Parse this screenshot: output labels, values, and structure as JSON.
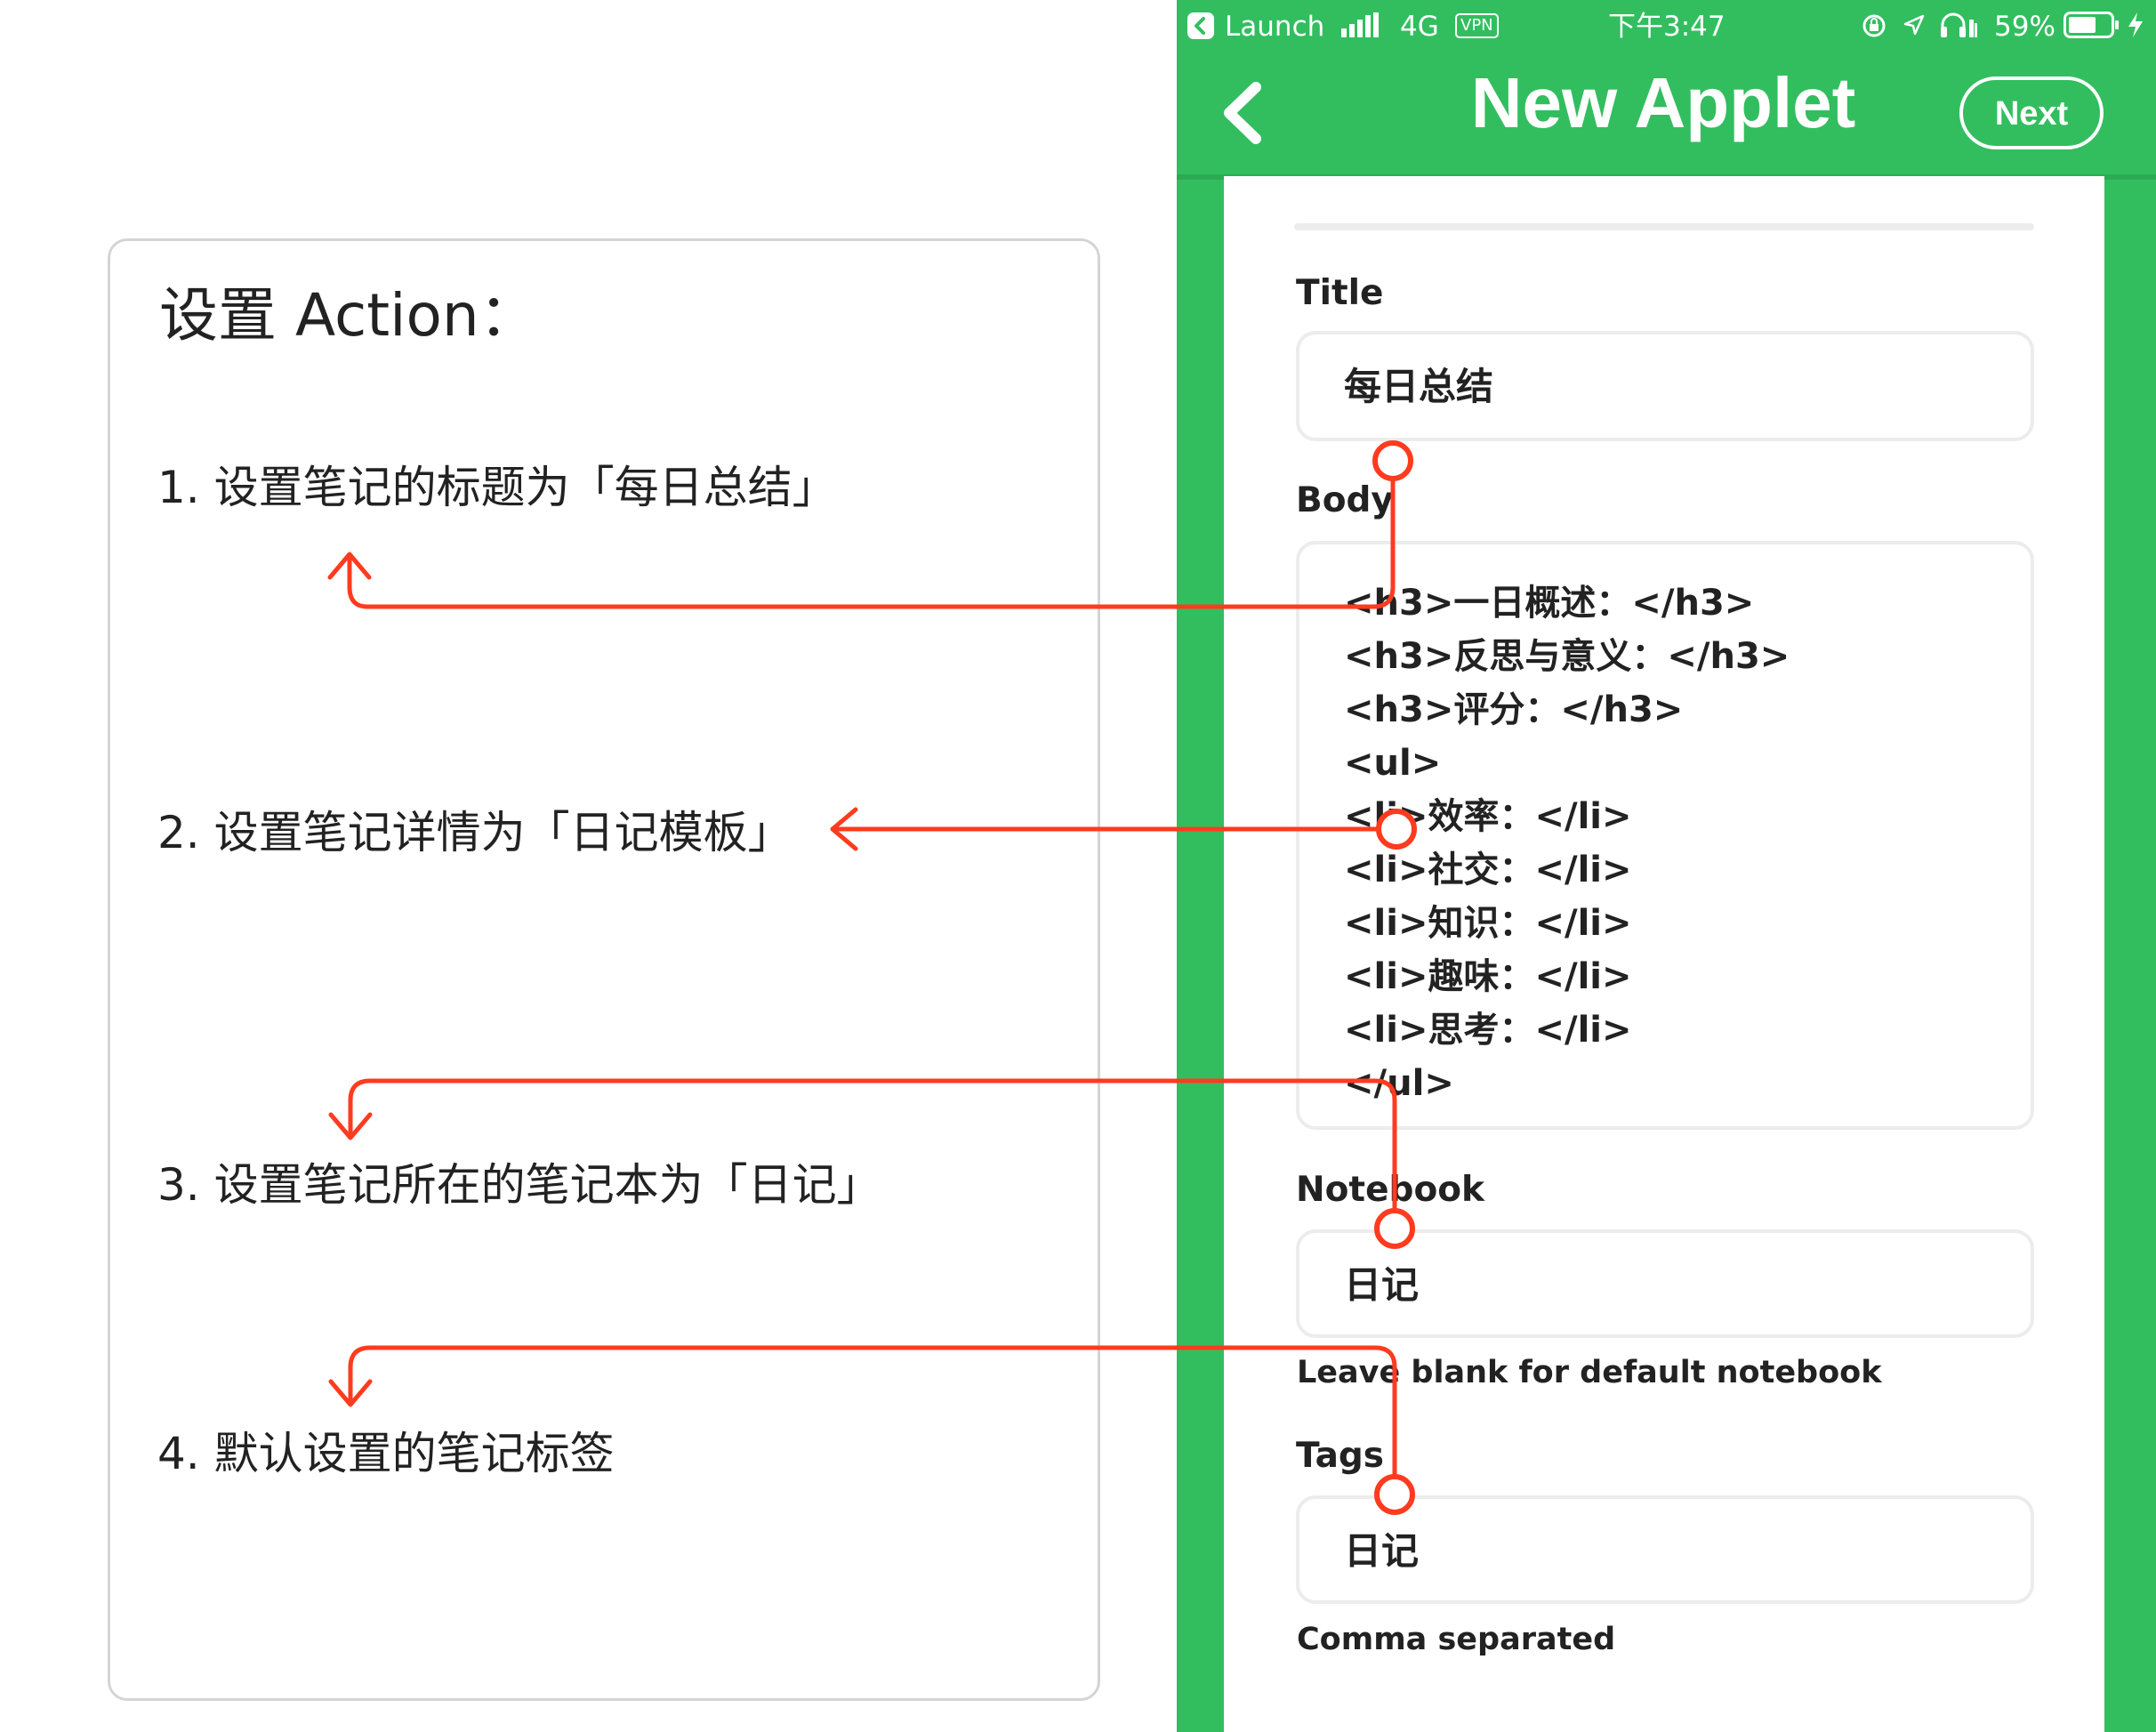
{
  "instructions": {
    "heading": "设置 Action：",
    "steps": [
      "1. 设置笔记的标题为「每日总结」",
      "2. 设置笔记详情为「日记模板」",
      "3. 设置笔记所在的笔记本为「日记」",
      "4. 默认设置的笔记标签"
    ]
  },
  "status_bar": {
    "back_app": "Launch",
    "network": "4G",
    "vpn": "VPN",
    "time": "下午3:47",
    "battery": "59%"
  },
  "nav": {
    "title": "New Applet",
    "next_label": "Next"
  },
  "form": {
    "title_label": "Title",
    "title_value": "每日总结",
    "body_label": "Body",
    "body_lines": [
      "<h3>一日概述：</h3>",
      "<h3>反思与意义：</h3>",
      "<h3>评分：</h3>",
      "<ul>",
      "<li>效率：</li>",
      "<li>社交：</li>",
      "<li>知识：</li>",
      "<li>趣味：</li>",
      "<li>思考：</li>",
      "</ul>"
    ],
    "notebook_label": "Notebook",
    "notebook_value": "日记",
    "notebook_helper": "Leave blank for default notebook",
    "tags_label": "Tags",
    "tags_value": "日记",
    "tags_helper": "Comma separated"
  },
  "colors": {
    "accent_green": "#32be5f",
    "annotation_red": "#ff3b1f"
  }
}
